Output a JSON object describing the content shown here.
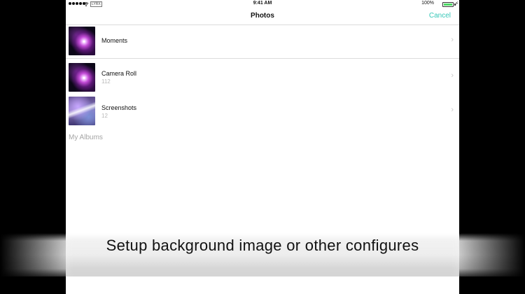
{
  "status_bar": {
    "carrier": "LYRX",
    "time": "9:41 AM",
    "battery_percent": "100%",
    "battery_level": 1.0,
    "icons": [
      "signal-dots-icon",
      "wifi-icon",
      "battery-icon",
      "charging-bolt-icon"
    ]
  },
  "nav": {
    "title": "Photos",
    "cancel_label": "Cancel",
    "accent_color": "#36c7b7"
  },
  "albums": [
    {
      "title": "Moments",
      "count": ""
    },
    {
      "title": "Camera Roll",
      "count": "112"
    },
    {
      "title": "Screenshots",
      "count": "12"
    }
  ],
  "section_header": "My Albums",
  "caption": "Setup background image or other configures"
}
